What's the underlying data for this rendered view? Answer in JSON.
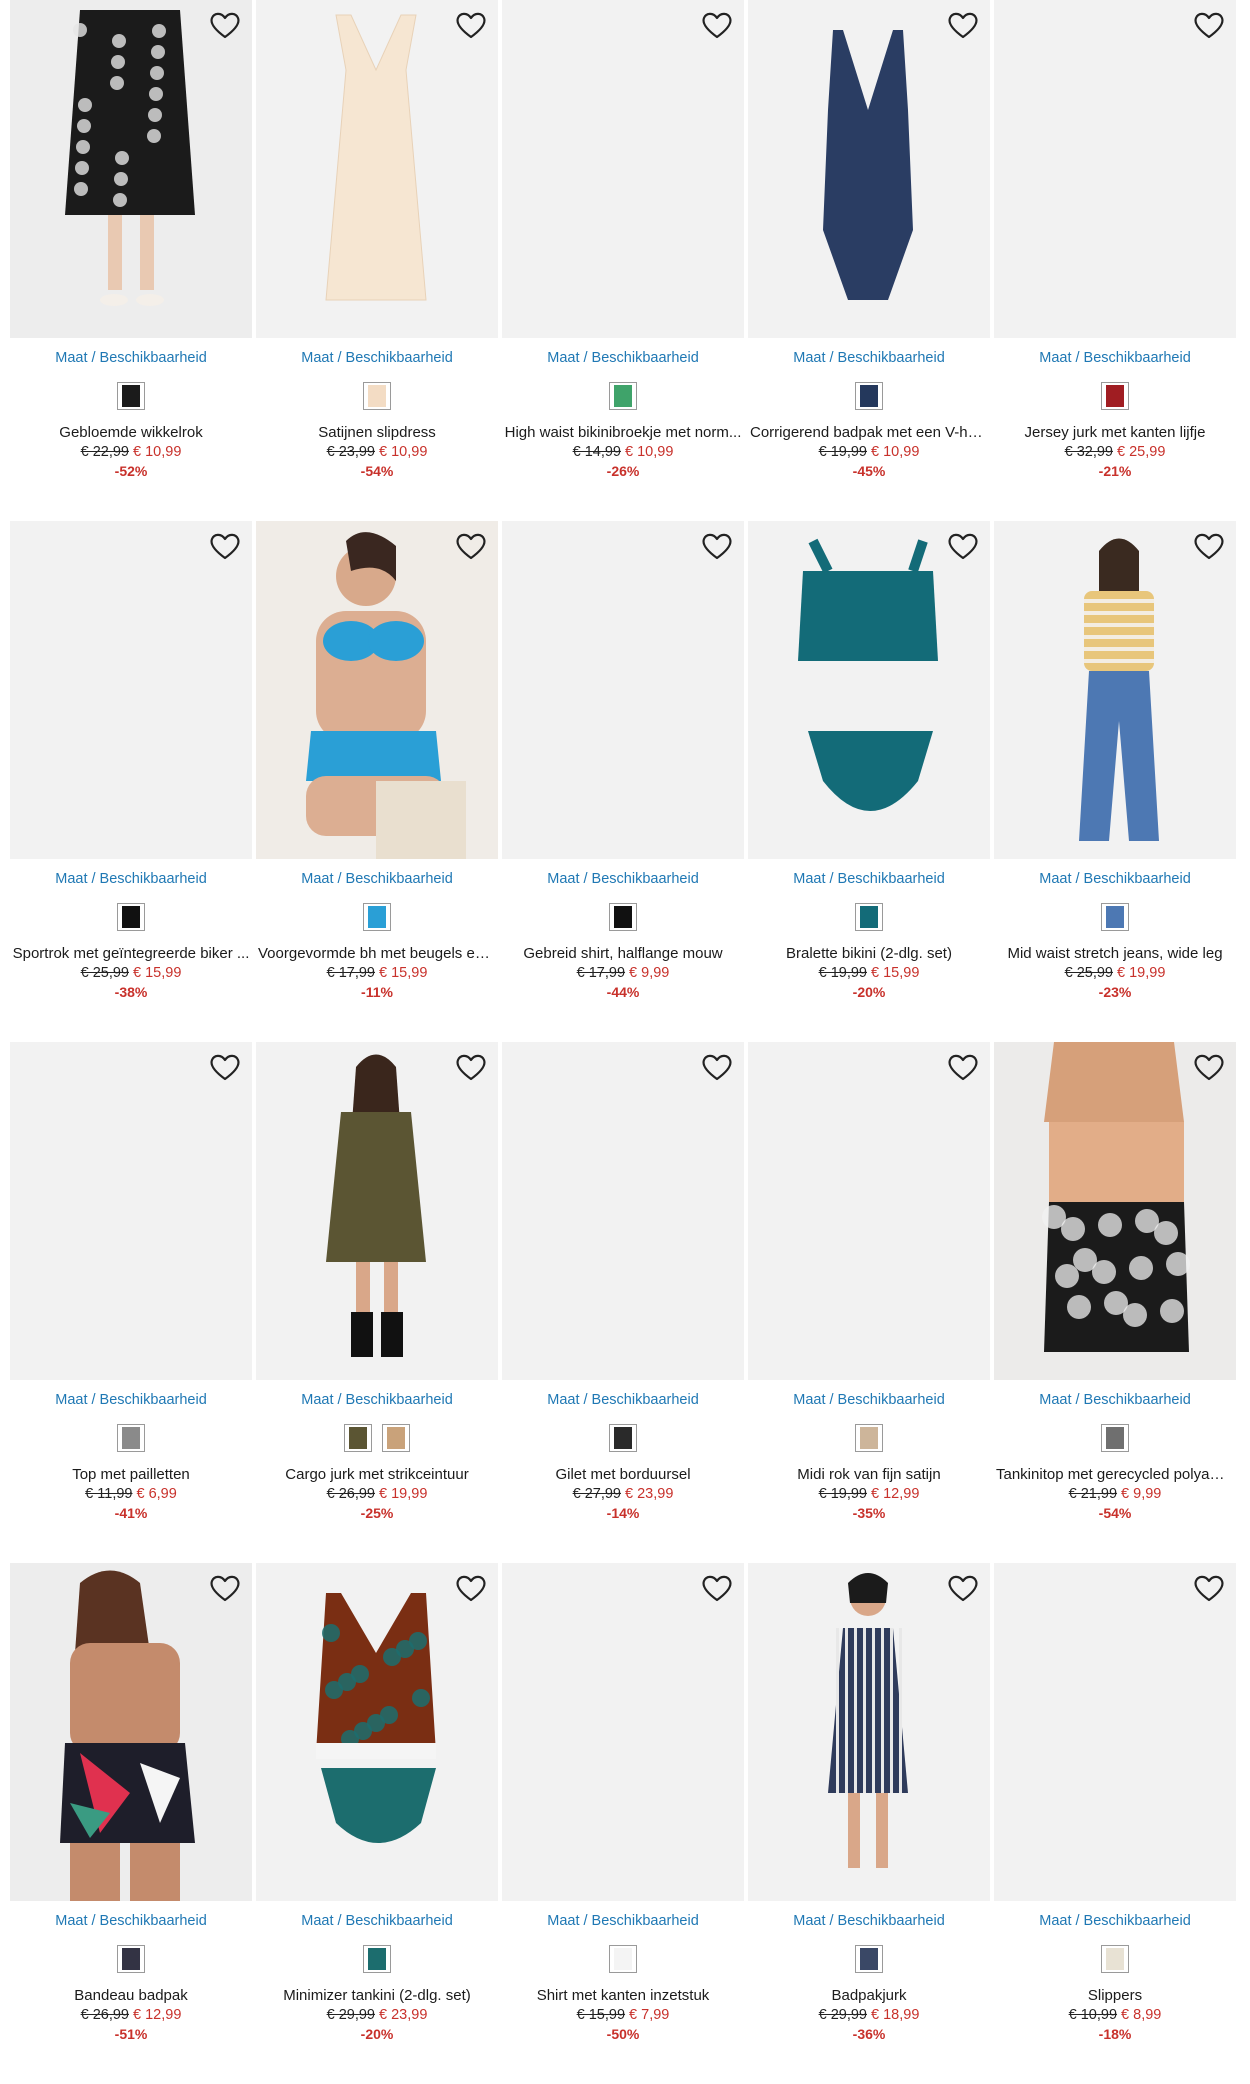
{
  "availability_label": "Maat / Beschikbaarheid",
  "favorite_icon": "heart-outline-icon",
  "colors": {
    "link": "#1f78b4",
    "price_sale": "#c8312b",
    "image_bg": "#f2f2f2"
  },
  "products": [
    {
      "name": "Gebloemde wikkelrok",
      "old_price": "€ 22,99",
      "new_price": "€ 10,99",
      "discount": "-52%",
      "swatches": [
        "#1b1b1b"
      ]
    },
    {
      "name": "Satijnen slipdress",
      "old_price": "€ 23,99",
      "new_price": "€ 10,99",
      "discount": "-54%",
      "swatches": [
        "#f3dcc4"
      ]
    },
    {
      "name": "High waist bikinibroekje met norm...",
      "old_price": "€ 14,99",
      "new_price": "€ 10,99",
      "discount": "-26%",
      "swatches": [
        "#3fa36a"
      ]
    },
    {
      "name": "Corrigerend badpak met een V-hals...",
      "old_price": "€ 19,99",
      "new_price": "€ 10,99",
      "discount": "-45%",
      "swatches": [
        "#24385c"
      ]
    },
    {
      "name": "Jersey jurk met kanten lijfje",
      "old_price": "€ 32,99",
      "new_price": "€ 25,99",
      "discount": "-21%",
      "swatches": [
        "#a01d22"
      ]
    },
    {
      "name": "Sportrok met geïntegreerde biker ...",
      "old_price": "€ 25,99",
      "new_price": "€ 15,99",
      "discount": "-38%",
      "swatches": [
        "#111111"
      ]
    },
    {
      "name": "Voorgevormde bh met beugels en g...",
      "old_price": "€ 17,99",
      "new_price": "€ 15,99",
      "discount": "-11%",
      "swatches": [
        "#2a9fd6"
      ]
    },
    {
      "name": "Gebreid shirt, halflange mouw",
      "old_price": "€ 17,99",
      "new_price": "€ 9,99",
      "discount": "-44%",
      "swatches": [
        "#111111"
      ]
    },
    {
      "name": "Bralette bikini (2-dlg. set)",
      "old_price": "€ 19,99",
      "new_price": "€ 15,99",
      "discount": "-20%",
      "swatches": [
        "#136b78"
      ]
    },
    {
      "name": "Mid waist stretch jeans, wide leg",
      "old_price": "€ 25,99",
      "new_price": "€ 19,99",
      "discount": "-23%",
      "swatches": [
        "#4d78b3"
      ]
    },
    {
      "name": "Top met pailletten",
      "old_price": "€ 11,99",
      "new_price": "€ 6,99",
      "discount": "-41%",
      "swatches": [
        "#8a8a8a"
      ]
    },
    {
      "name": "Cargo jurk met strikceintuur",
      "old_price": "€ 26,99",
      "new_price": "€ 19,99",
      "discount": "-25%",
      "swatches": [
        "#5b5533",
        "#c9a27a"
      ]
    },
    {
      "name": "Gilet met borduursel",
      "old_price": "€ 27,99",
      "new_price": "€ 23,99",
      "discount": "-14%",
      "swatches": [
        "#2a2a2a"
      ]
    },
    {
      "name": "Midi rok van fijn satijn",
      "old_price": "€ 19,99",
      "new_price": "€ 12,99",
      "discount": "-35%",
      "swatches": [
        "#cdb59a"
      ]
    },
    {
      "name": "Tankinitop met gerecycled polyamide",
      "old_price": "€ 21,99",
      "new_price": "€ 9,99",
      "discount": "-54%",
      "swatches": [
        "#6f6f6f"
      ]
    },
    {
      "name": "Bandeau badpak",
      "old_price": "€ 26,99",
      "new_price": "€ 12,99",
      "discount": "-51%",
      "swatches": [
        "#333344"
      ]
    },
    {
      "name": "Minimizer tankini (2-dlg. set)",
      "old_price": "€ 29,99",
      "new_price": "€ 23,99",
      "discount": "-20%",
      "swatches": [
        "#1c6d6e"
      ]
    },
    {
      "name": "Shirt met kanten inzetstuk",
      "old_price": "€ 15,99",
      "new_price": "€ 7,99",
      "discount": "-50%",
      "swatches": [
        "#f4f4f4"
      ]
    },
    {
      "name": "Badpakjurk",
      "old_price": "€ 29,99",
      "new_price": "€ 18,99",
      "discount": "-36%",
      "swatches": [
        "#3a4866"
      ]
    },
    {
      "name": "Slippers",
      "old_price": "€ 10,99",
      "new_price": "€ 8,99",
      "discount": "-18%",
      "swatches": [
        "#e8e2d4"
      ]
    }
  ]
}
